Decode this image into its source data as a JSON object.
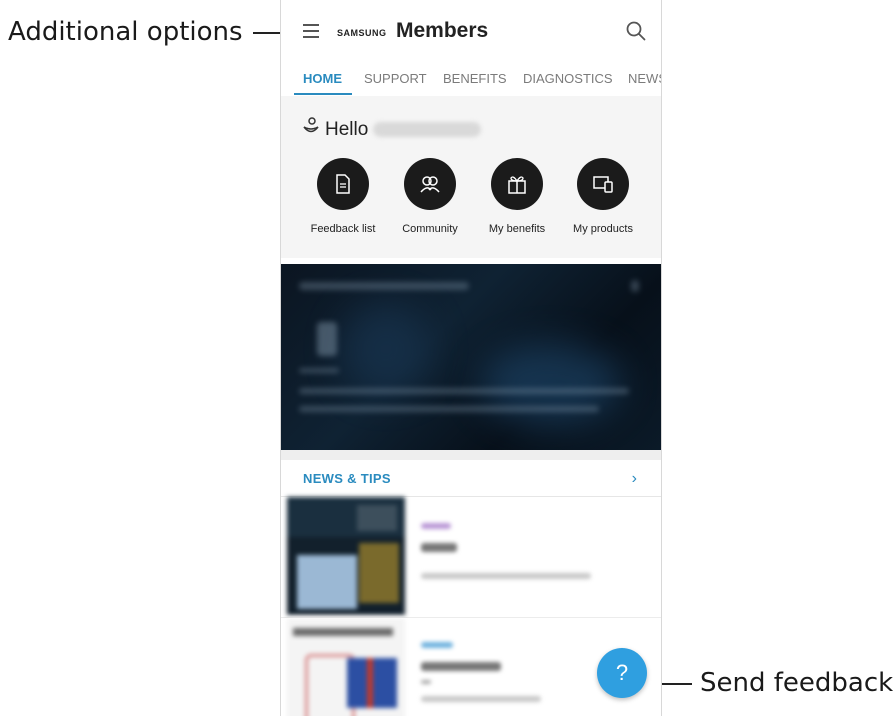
{
  "callouts": {
    "additional_options": "Additional options",
    "send_feedback": "Send feedback."
  },
  "app": {
    "brand_samsung": "SAMSUNG",
    "brand_members": "Members"
  },
  "tabs": [
    {
      "label": "HOME",
      "active": true
    },
    {
      "label": "SUPPORT",
      "active": false
    },
    {
      "label": "BENEFITS",
      "active": false
    },
    {
      "label": "DIAGNOSTICS",
      "active": false
    },
    {
      "label": "NEWS",
      "active": false
    }
  ],
  "greeting": {
    "hello": "Hello"
  },
  "shortcuts": [
    {
      "label": "Feedback list",
      "icon": "document-icon"
    },
    {
      "label": "Community",
      "icon": "people-icon"
    },
    {
      "label": "My benefits",
      "icon": "gift-icon"
    },
    {
      "label": "My products",
      "icon": "devices-icon"
    }
  ],
  "news": {
    "title": "NEWS & TIPS",
    "more_icon": "chevron-right-icon"
  },
  "fab": {
    "label": "?"
  },
  "colors": {
    "accent": "#2a8bbf",
    "fab": "#2f9fe0"
  }
}
